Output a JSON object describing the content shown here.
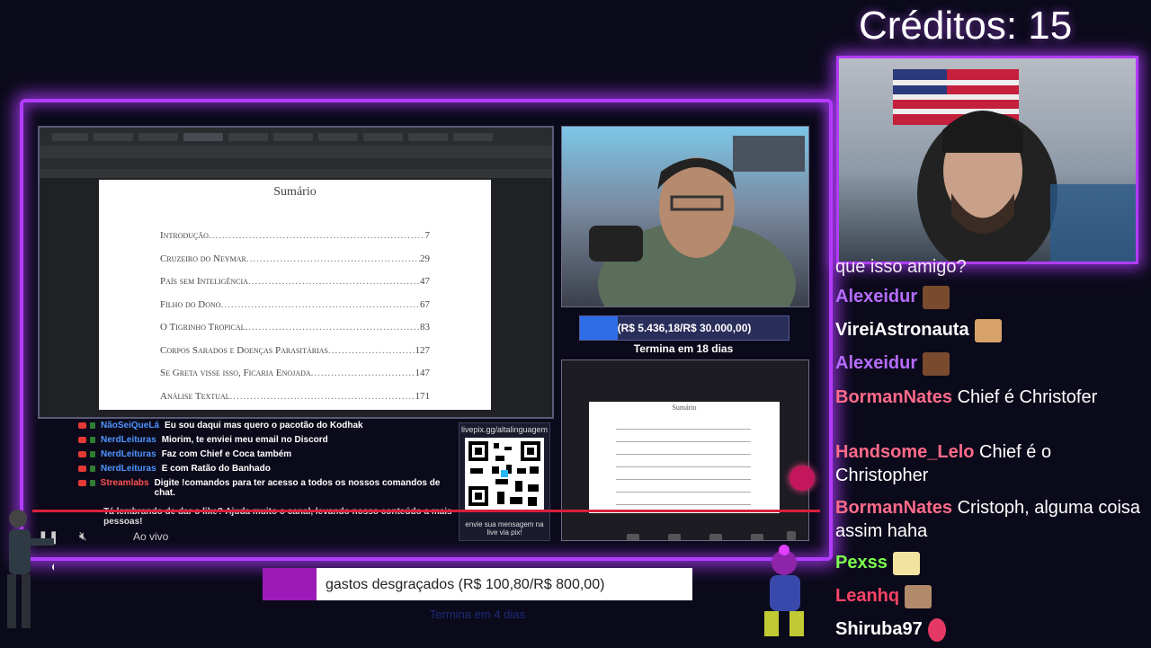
{
  "overlay": {
    "credits": "Créditos: 15",
    "colors": {
      "neon": "#b23cff",
      "goal_fill": "#2d6ee8",
      "goal2_fill": "#9c1bb8"
    }
  },
  "screen_share": {
    "pdf_title": "Sumário",
    "toc": [
      {
        "title": "Introdução",
        "page": "7"
      },
      {
        "title": "Cruzeiro do Neymar",
        "page": "29"
      },
      {
        "title": "País sem Inteligência",
        "page": "47"
      },
      {
        "title": "Filho do Dono",
        "page": "67"
      },
      {
        "title": "O Tigrinho Tropical",
        "page": "83"
      },
      {
        "title": "Corpos Sarados e Doenças Parasitárias",
        "page": "127"
      },
      {
        "title": "Se Greta visse isso, Ficaria Enojada",
        "page": "147"
      },
      {
        "title": "Análise Textual",
        "page": "171"
      }
    ]
  },
  "goal_main": {
    "text": "(R$ 5.436,18/R$ 30.000,00)",
    "progress": 0.181,
    "subtitle": "Termina em 18 dias"
  },
  "second_screen": {
    "pdf_title": "Sumário"
  },
  "overlay_chat": [
    {
      "name": "NãoSeiQueLá",
      "message": "Eu sou daqui mas quero o pacotão do Kodhak"
    },
    {
      "name": "NerdLeituras",
      "message": "Miorim, te enviei meu email no Discord"
    },
    {
      "name": "NerdLeituras",
      "message": "Faz com Chief e Coca também"
    },
    {
      "name": "NerdLeituras",
      "message": "E com Ratão do Banhado"
    },
    {
      "name": "Streamlabs",
      "message": "Digite !comandos para ter acesso a todos os nossos comandos de chat."
    },
    {
      "name": "",
      "message": "Tá lembrando de dar o like? Ajuda muito o canal, levando nosso conteúdo a mais pessoas!"
    }
  ],
  "qr": {
    "title": "livepix.gg/altalinguagem",
    "caption": "envie sua mensagem na live via pix!"
  },
  "player": {
    "label": "Ao vivo"
  },
  "goal_secondary": {
    "text": "gastos desgraçados (R$ 100,80/R$ 800,00)",
    "progress": 0.126,
    "subtitle": "Termina em 4 dias"
  },
  "right_chat": [
    {
      "name": "",
      "message": "que isso amigo?",
      "color": "#ffffff"
    },
    {
      "name": "Alexeidur",
      "message": "",
      "color": "#b56cff",
      "emote": "face-emote"
    },
    {
      "name": "VireiAstronauta",
      "message": "",
      "color": "#ffffff",
      "emote": "laugh-emote"
    },
    {
      "name": "Alexeidur",
      "message": "",
      "color": "#b56cff",
      "emote": "face-emote"
    },
    {
      "name": "BormanNates",
      "message": "Chief é Christofer",
      "color": "#ff6b8a"
    },
    {
      "name": "Handsome_Lelo",
      "message": "Chief é o Christopher",
      "color": "#ff6b8a"
    },
    {
      "name": "BormanNates",
      "message": "Cristoph, alguma coisa assim haha",
      "color": "#ff6b8a"
    },
    {
      "name": "Pexss",
      "message": "",
      "color": "#7dff4e",
      "emote": "anime-emote"
    },
    {
      "name": "Leanhq",
      "message": "",
      "color": "#ff4466",
      "emote": "cat-emote"
    },
    {
      "name": "Shiruba97",
      "message": "",
      "color": "#ffffff",
      "emote": "heart-emote"
    }
  ]
}
